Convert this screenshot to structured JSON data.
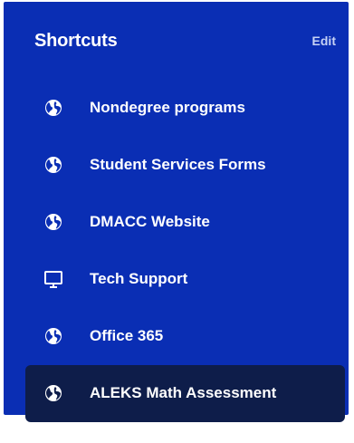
{
  "shortcuts": {
    "title": "Shortcuts",
    "edit_label": "Edit",
    "items": [
      {
        "label": "Nondegree programs",
        "icon": "globe-icon"
      },
      {
        "label": "Student Services Forms",
        "icon": "globe-icon"
      },
      {
        "label": "DMACC Website",
        "icon": "globe-icon"
      },
      {
        "label": "Tech Support",
        "icon": "monitor-icon"
      },
      {
        "label": "Office 365",
        "icon": "globe-icon"
      },
      {
        "label": "ALEKS Math Assessment",
        "icon": "globe-icon",
        "active": true
      }
    ]
  },
  "colors": {
    "panel_bg": "#0a2eb4",
    "active_bg": "#0e1d4a",
    "text": "#ffffff",
    "edit_text": "#c7d3f5"
  }
}
